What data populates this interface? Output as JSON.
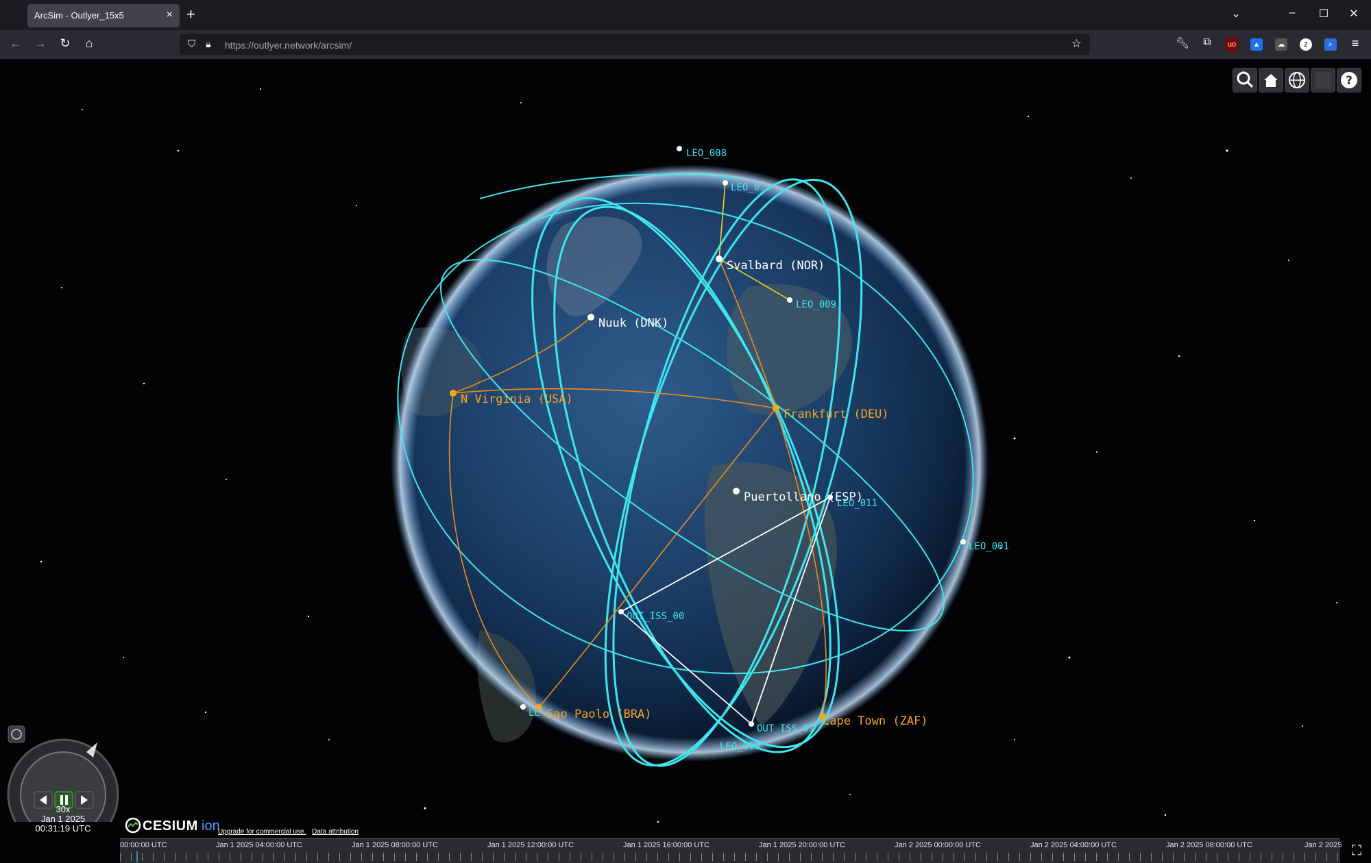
{
  "browser": {
    "tab_title": "ArcSim - Outlyer_15x5",
    "tab_close": "×",
    "new_tab": "+",
    "url_host": "https://outlyer.network",
    "url_path": "/arcsim/"
  },
  "cesium": {
    "anim_speed": "30x",
    "anim_date": "Jan 1 2025",
    "anim_time": "00:31:19 UTC",
    "logo_word": "CESIUM",
    "logo_ion": "ion",
    "link_upgrade": "Upgrade for commercial use.",
    "link_attribution": "Data attribution"
  },
  "timeline": {
    "ticks": [
      "00:00:00 UTC",
      "Jan 1 2025 04:00:00 UTC",
      "Jan 1 2025 08:00:00 UTC",
      "Jan 1 2025 12:00:00 UTC",
      "Jan 1 2025 16:00:00 UTC",
      "Jan 1 2025 20:00:00 UTC",
      "Jan 2 2025 00:00:00 UTC",
      "Jan 2 2025 04:00:00 UTC",
      "Jan 2 2025 08:00:00 UTC",
      "Jan 2 2025"
    ]
  },
  "ground_stations_white": [
    "Svalbard (NOR)",
    "Nuuk (DNK)",
    "Puertollano (ESP)"
  ],
  "ground_stations_orange": [
    "N Virginia (USA)",
    "Frankfurt (DEU)",
    "Sao Paolo (BRA)",
    "Cape Town (ZAF)"
  ],
  "satellites": [
    "LEO_008",
    "LEO_0..",
    "LEO_009",
    "LEO_011",
    "LEO_001",
    "OUT_ISS_00",
    "OUT_ISS_01",
    "LEO_010",
    "LE"
  ],
  "colors": {
    "orbit": "#3ee6f0",
    "orange_link": "#f08a1a",
    "yellow_link": "#f5d020",
    "white_link": "#ffffff",
    "station_white": "#ffffff",
    "station_orange": "#f5a623"
  }
}
